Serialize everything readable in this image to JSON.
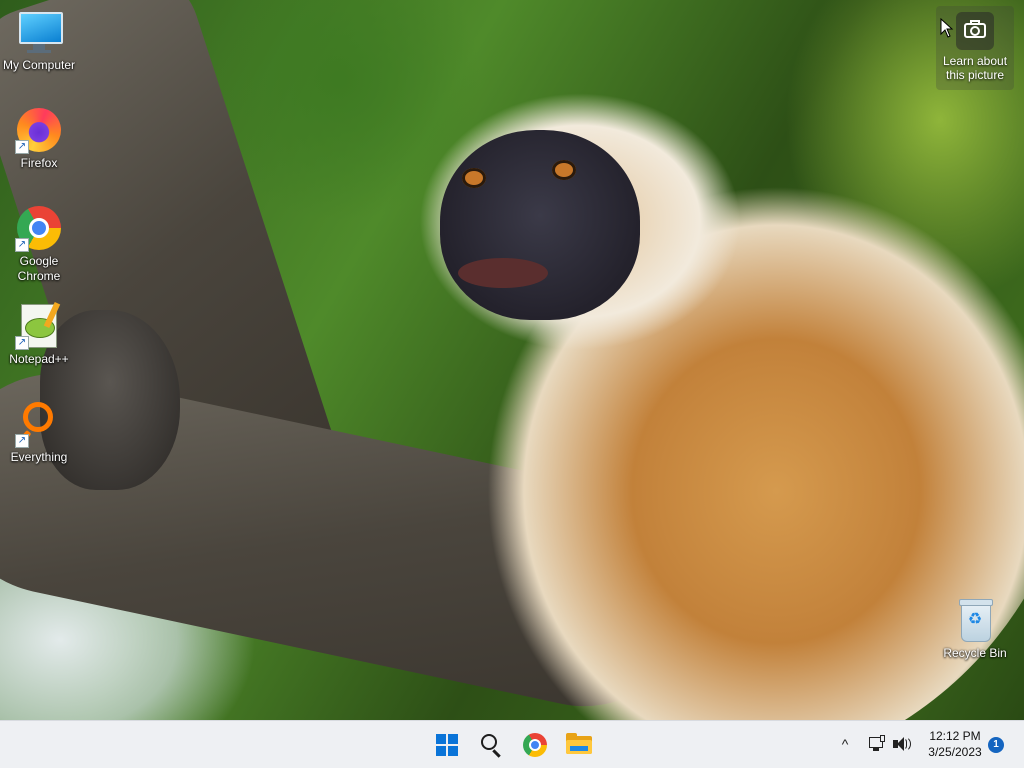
{
  "desktop": {
    "icons": [
      {
        "label": "My Computer",
        "icon": "computer-icon"
      },
      {
        "label": "Firefox",
        "icon": "firefox-icon"
      },
      {
        "label": "Google Chrome",
        "icon": "chrome-icon"
      },
      {
        "label": "Notepad++",
        "icon": "notepadpp-icon"
      },
      {
        "label": "Everything",
        "icon": "everything-icon"
      },
      {
        "label": "Recycle Bin",
        "icon": "recycle-bin-icon"
      }
    ],
    "spotlight": {
      "label": "Learn about this picture",
      "icon": "camera-icon"
    },
    "wallpaper": "golden langur monkey on tree branch"
  },
  "taskbar": {
    "pinned": [
      {
        "name": "Start",
        "icon": "windows-start-icon"
      },
      {
        "name": "Search",
        "icon": "search-icon"
      },
      {
        "name": "Google Chrome",
        "icon": "chrome-icon"
      },
      {
        "name": "File Explorer",
        "icon": "folder-icon"
      }
    ],
    "tray": {
      "chevron": "^",
      "time": "12:12 PM",
      "date": "3/25/2023",
      "notification_count": "1"
    }
  },
  "colors": {
    "taskbar_bg": "#eef0f3",
    "start_blue": "#0a74d8",
    "badge_blue": "#1565c0"
  }
}
